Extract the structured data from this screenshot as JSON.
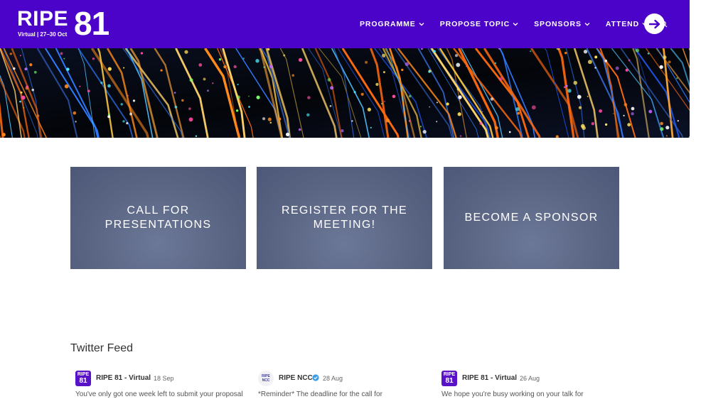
{
  "header": {
    "logo_word": "RIPE",
    "logo_number": "81",
    "logo_sub": "Virtual | 27–30 Oct",
    "nav": [
      {
        "label": "PROGRAMME"
      },
      {
        "label": "PROPOSE TOPIC"
      },
      {
        "label": "SPONSORS"
      },
      {
        "label": "ATTEND"
      }
    ],
    "search_icon": "search-icon",
    "arrow_icon": "arrow-right-icon"
  },
  "cards": [
    {
      "label": "CALL FOR PRESENTATIONS"
    },
    {
      "label": "REGISTER FOR THE MEETING!"
    },
    {
      "label": "BECOME A SPONSOR"
    }
  ],
  "twitter": {
    "title": "Twitter Feed",
    "tweets": [
      {
        "avatar_line1": "RIPE",
        "avatar_line2": "81",
        "name": "RIPE 81 - Virtual",
        "date": "18 Sep",
        "text": "You've only got one week left to submit your proposal"
      },
      {
        "avatar_line1": "RIPE",
        "avatar_line2": "NCC",
        "name": "RIPE NCC",
        "date": "28 Aug",
        "text": "*Reminder* The deadline for the call for"
      },
      {
        "avatar_line1": "RIPE",
        "avatar_line2": "81",
        "name": "RIPE 81 - Virtual",
        "date": "26 Aug",
        "text": "We hope you're busy working on your talk for"
      }
    ]
  },
  "colors": {
    "header_bg": "#4b03c9",
    "card_bg": "#5a6584",
    "banner_bg": "#05070f"
  }
}
